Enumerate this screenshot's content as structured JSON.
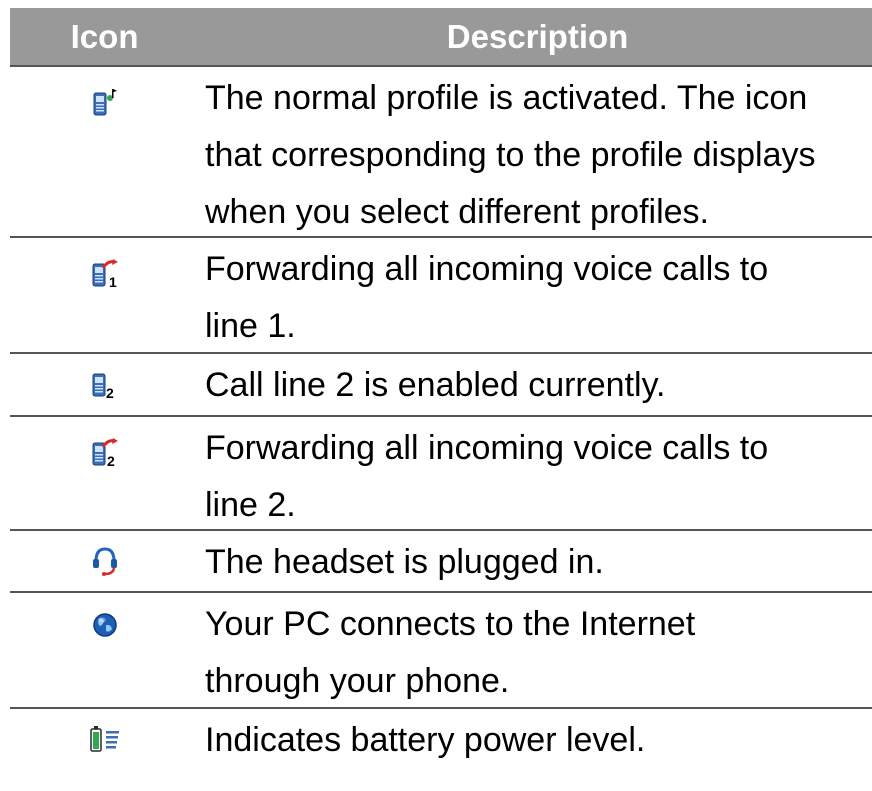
{
  "header": {
    "icon_label": "Icon",
    "description_label": "Description"
  },
  "rows": [
    {
      "icon": "normal-profile-icon",
      "description": "The normal profile is activated. The icon\nthat corresponding to the profile displays\nwhen you select different profiles."
    },
    {
      "icon": "forward-line1-icon",
      "description": "Forwarding all incoming voice calls to\nline 1."
    },
    {
      "icon": "call-line2-icon",
      "description": "Call line 2 is enabled currently."
    },
    {
      "icon": "forward-line2-icon",
      "description": "Forwarding all incoming voice calls to\nline 2."
    },
    {
      "icon": "headset-icon",
      "description": "The headset is plugged in."
    },
    {
      "icon": "internet-globe-icon",
      "description": "Your PC connects to the Internet\nthrough your phone."
    },
    {
      "icon": "battery-level-icon",
      "description": "Indicates battery power level."
    }
  ],
  "colors": {
    "header_bg": "#999999",
    "header_text": "#ffffff",
    "rule": "#555555"
  }
}
